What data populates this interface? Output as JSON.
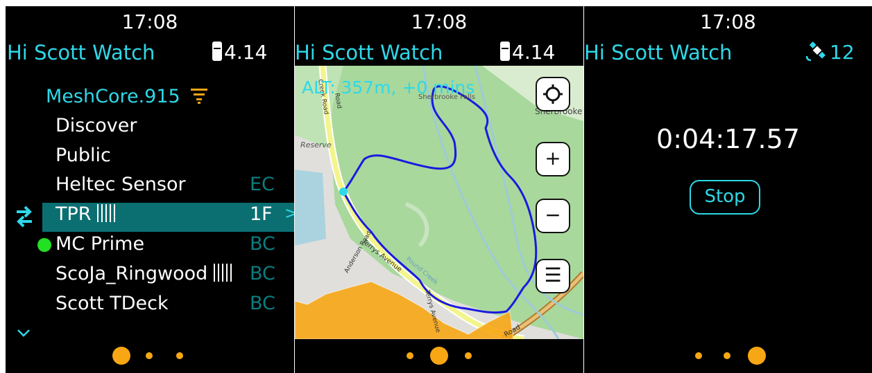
{
  "status": {
    "time": "17:08",
    "device_name": "Hi Scott Watch",
    "battery_level": "4.14",
    "satellite_count": "12"
  },
  "contacts_screen": {
    "channel": "MeshCore.915",
    "items": [
      {
        "name": "Discover",
        "code": ""
      },
      {
        "name": "Public",
        "code": ""
      },
      {
        "name": "Heltec Sensor",
        "code": "EC"
      },
      {
        "name": "TPR",
        "code": "1F",
        "arrow": ">"
      },
      {
        "name": "MC Prime",
        "code": "BC"
      },
      {
        "name": "ScoJa_Ringwood",
        "code": "BC"
      },
      {
        "name": "Scott TDeck",
        "code": "BC"
      }
    ]
  },
  "map_screen": {
    "overlay": "ALT: 357m, +0 mins",
    "labels": {
      "sherbrooke": "Sherbrooke",
      "sherbrooke_falls": "Sherbrooke Falls",
      "reserve": "Reserve",
      "terrys_avenue": "Terrys Avenue",
      "anderson_road": "Anderson Road",
      "pound_creek": "Pound Creek",
      "creek_road": "Creek Road",
      "road": "Road",
      "terrys_avenue_2": "Terrys Avenue",
      "road_2": "Road"
    },
    "buttons": {
      "zoom_in": "+",
      "zoom_out": "−",
      "menu": "☰"
    }
  },
  "timer_screen": {
    "elapsed": "0:04:17.57",
    "stop_label": "Stop"
  },
  "colors": {
    "accent": "#2fd8e8",
    "selection": "#0b6f72",
    "page_dot": "#f7a614",
    "track": "#1a1adf",
    "forest": "#a8d89c"
  }
}
